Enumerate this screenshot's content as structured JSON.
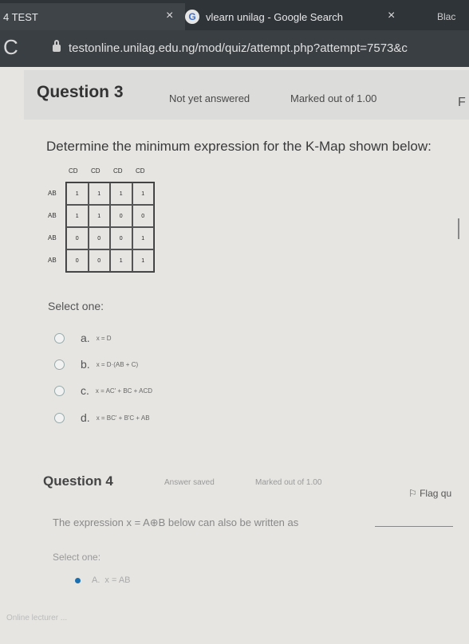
{
  "browser": {
    "tabs": [
      {
        "label": "4 TEST",
        "close": "×"
      },
      {
        "label": "vlearn unilag - Google Search",
        "close": "×",
        "icon": "google-icon"
      },
      {
        "label": "Blac"
      }
    ],
    "url": "testonline.unilag.edu.ng/mod/quiz/attempt.php?attempt=7573&c"
  },
  "question3": {
    "title": "Question 3",
    "state": "Not yet answered",
    "mark": "Marked out of 1.00",
    "flag_label": "F",
    "text": "Determine the minimum expression for the K-Map shown below:",
    "kmap": {
      "col_headers": [
        "CD",
        "CD",
        "CD",
        "CD"
      ],
      "row_headers": [
        "AB",
        "AB",
        "AB",
        "AB"
      ],
      "cells": [
        [
          "1",
          "1",
          "1",
          "1"
        ],
        [
          "1",
          "1",
          "0",
          "0"
        ],
        [
          "0",
          "0",
          "0",
          "1"
        ],
        [
          "0",
          "0",
          "1",
          "1"
        ]
      ]
    },
    "select_label": "Select one:",
    "options": [
      {
        "label": "a.",
        "expr": "x = D"
      },
      {
        "label": "b.",
        "expr": "x = D·(AB + C)"
      },
      {
        "label": "c.",
        "expr": "x = AC' + BC + ACD"
      },
      {
        "label": "d.",
        "expr": "x = BC' + B'C + AB"
      }
    ]
  },
  "question4": {
    "title": "Question 4",
    "state": "Answer saved",
    "mark": "Marked out of 1.00",
    "flag_label": "Flag qu",
    "text": "The expression x = A⊕B below can also be written as",
    "select_label": "Select one:",
    "options": [
      {
        "label": "A.",
        "expr": "x = AB"
      }
    ]
  },
  "footer": {
    "text": "Online lecturer ..."
  }
}
